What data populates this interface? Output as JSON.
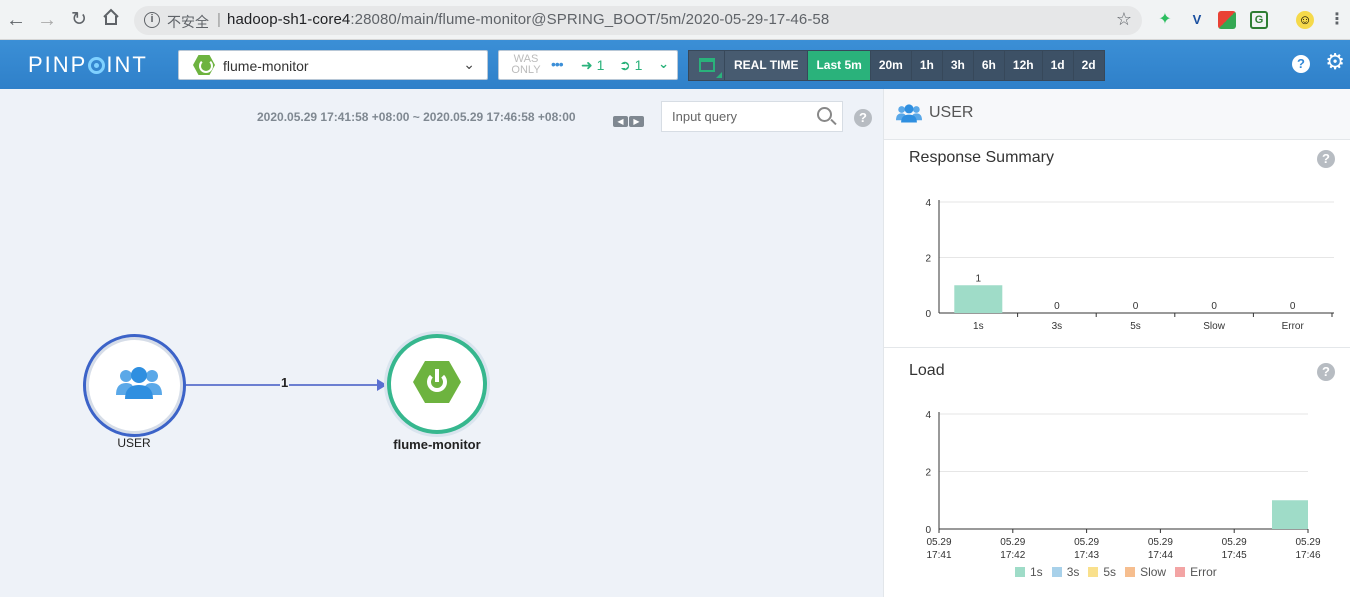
{
  "browser": {
    "insecure_label": "不安全",
    "url_host": "hadoop-sh1-core4",
    "url_rest": ":28080/main/flume-monitor@SPRING_BOOT/5m/2020-05-29-17-46-58"
  },
  "header": {
    "logo_left": "PINP",
    "logo_right": "INT",
    "app_select": {
      "label": "flume-monitor",
      "icon": "spring-boot-icon"
    },
    "was_only": {
      "label_line1": "WAS",
      "label_line2": "ONLY",
      "inbound": "1",
      "outbound": "1"
    },
    "time_buttons": [
      {
        "label": "REAL TIME",
        "active": false
      },
      {
        "label": "Last 5m",
        "active": true
      },
      {
        "label": "20m",
        "active": false
      },
      {
        "label": "1h",
        "active": false
      },
      {
        "label": "3h",
        "active": false
      },
      {
        "label": "6h",
        "active": false
      },
      {
        "label": "12h",
        "active": false
      },
      {
        "label": "1d",
        "active": false
      },
      {
        "label": "2d",
        "active": false
      }
    ]
  },
  "server_map": {
    "time_range": "2020.05.29 17:41:58 +08:00 ~ 2020.05.29 17:46:58 +08:00",
    "query_placeholder": "Input query",
    "nodes": [
      {
        "label": "USER",
        "icon": "users-icon"
      },
      {
        "label": "flume-monitor",
        "icon": "spring-boot-icon"
      }
    ],
    "edge": {
      "label": "1"
    }
  },
  "panel": {
    "title": "USER",
    "response_summary_title": "Response Summary",
    "load_title": "Load"
  },
  "colors": {
    "c1s": "#9fdcc8",
    "c3s": "#a8d1ea",
    "c5s": "#f9e08c",
    "slow": "#f6be8f",
    "error": "#f3a4a4"
  },
  "chart_data": [
    {
      "type": "bar",
      "title": "Response Summary",
      "categories": [
        "1s",
        "3s",
        "5s",
        "Slow",
        "Error"
      ],
      "values": [
        1,
        0,
        0,
        0,
        0
      ],
      "ylim": [
        0,
        4
      ],
      "yticks": [
        0,
        2,
        4
      ],
      "grid": true
    },
    {
      "type": "bar",
      "title": "Load",
      "categories": [
        "05.29 17:41",
        "05.29 17:42",
        "05.29 17:43",
        "05.29 17:44",
        "05.29 17:45",
        "05.29 17:46"
      ],
      "series": [
        {
          "name": "1s",
          "values": [
            0,
            0,
            0,
            0,
            0,
            1
          ]
        },
        {
          "name": "3s",
          "values": [
            0,
            0,
            0,
            0,
            0,
            0
          ]
        },
        {
          "name": "5s",
          "values": [
            0,
            0,
            0,
            0,
            0,
            0
          ]
        },
        {
          "name": "Slow",
          "values": [
            0,
            0,
            0,
            0,
            0,
            0
          ]
        },
        {
          "name": "Error",
          "values": [
            0,
            0,
            0,
            0,
            0,
            0
          ]
        }
      ],
      "ylim": [
        0,
        4
      ],
      "yticks": [
        0,
        2,
        4
      ],
      "legend": "bottom",
      "grid": true
    }
  ]
}
